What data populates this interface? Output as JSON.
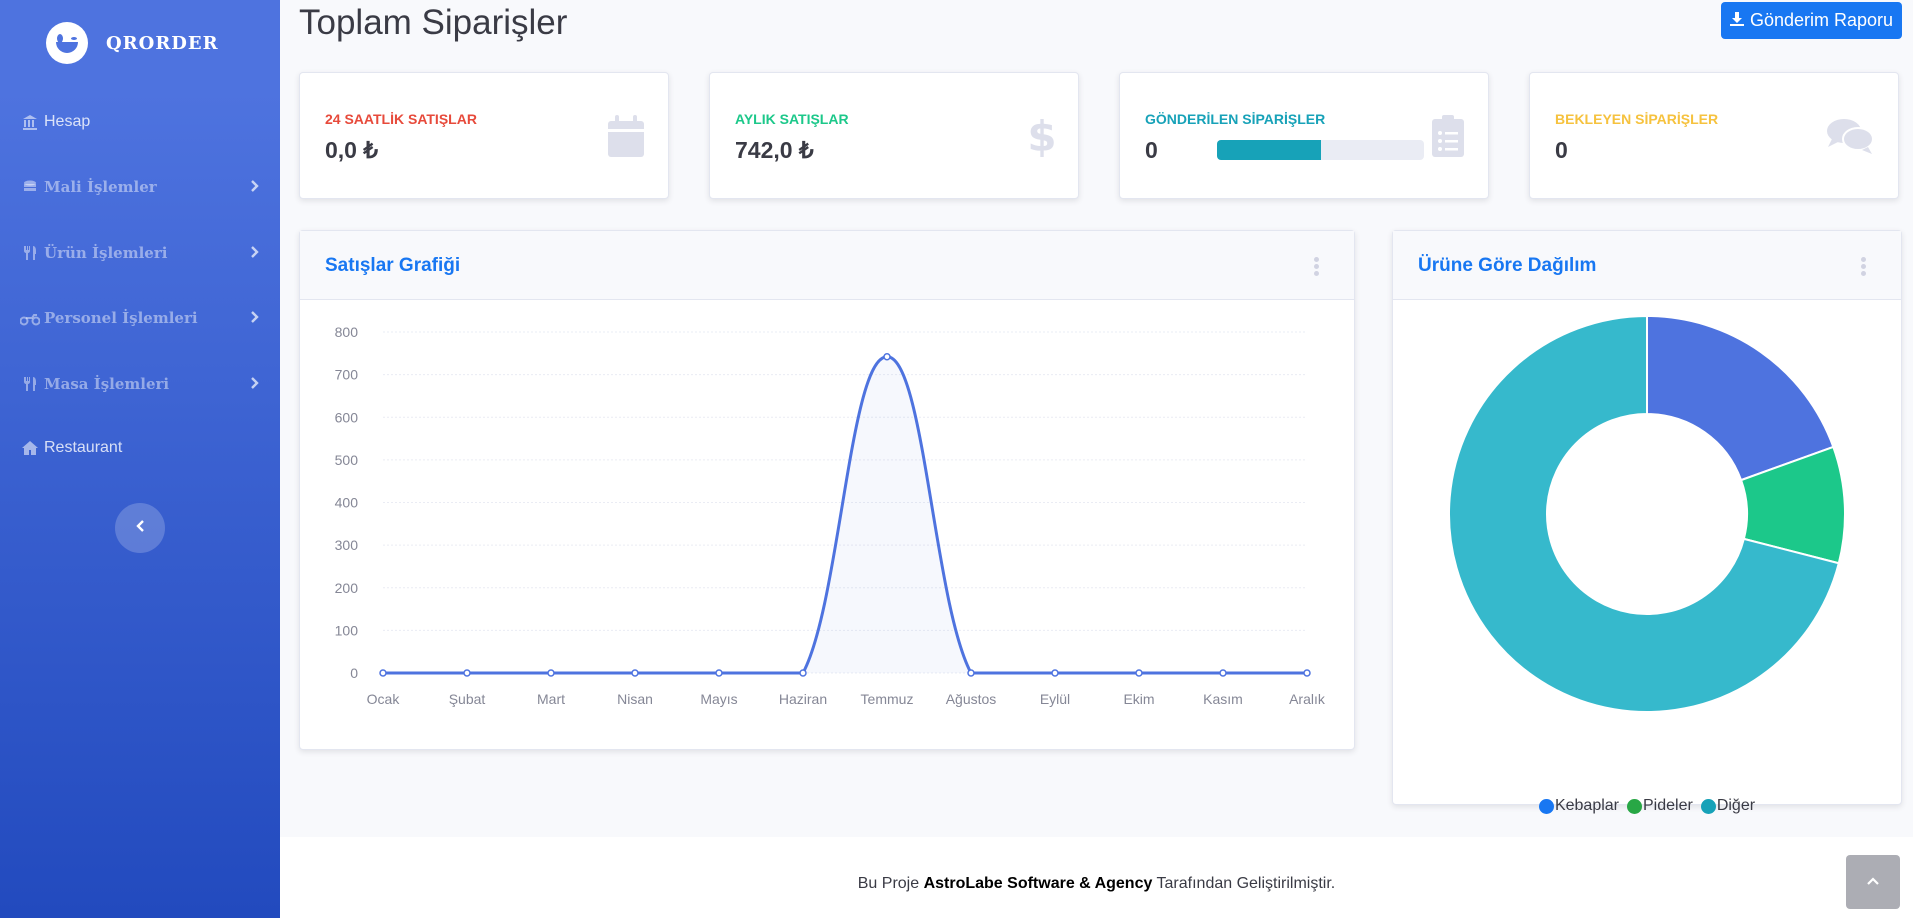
{
  "brand": {
    "name": "QRORDER"
  },
  "sidebar": {
    "items": [
      {
        "label": "Hesap"
      },
      {
        "label": "Mali İşlemler"
      },
      {
        "label": "Ürün İşlemleri"
      },
      {
        "label": "Personel İşlemleri"
      },
      {
        "label": "Masa İşlemleri"
      },
      {
        "label": "Restaurant"
      }
    ]
  },
  "header": {
    "title": "Toplam Siparişler",
    "report_button": "Gönderim Raporu"
  },
  "stats": [
    {
      "label": "24 SAATLİK SATIŞLAR",
      "value": "0,0 ₺",
      "color": "#e74a3b",
      "icon": "calendar-icon"
    },
    {
      "label": "AYLIK SATIŞLAR",
      "value": "742,0 ₺",
      "color": "#1cc88a",
      "icon": "dollar-icon"
    },
    {
      "label": "GÖNDERİLEN SİPARİŞLER",
      "value": "0",
      "color": "#17a2b8",
      "icon": "clipboard-list-icon",
      "progress": 0.5
    },
    {
      "label": "BEKLEYEN SİPARİŞLER",
      "value": "0",
      "color": "#f6c23e",
      "icon": "comments-icon"
    }
  ],
  "sales_chart": {
    "title": "Satışlar Grafiği",
    "chart_data": {
      "type": "area",
      "categories": [
        "Ocak",
        "Şubat",
        "Mart",
        "Nisan",
        "Mayıs",
        "Haziran",
        "Temmuz",
        "Ağustos",
        "Eylül",
        "Ekim",
        "Kasım",
        "Aralık"
      ],
      "series": [
        {
          "values": [
            0,
            0,
            0,
            0,
            0,
            0,
            742,
            0,
            0,
            0,
            0,
            0
          ]
        }
      ],
      "yticks": [
        0,
        100,
        200,
        300,
        400,
        500,
        600,
        700,
        800
      ],
      "ylim": [
        0,
        800
      ],
      "color": "#4e73df",
      "grid": true
    }
  },
  "distribution_chart": {
    "title": "Ürüne Göre Dağılım",
    "chart_data": {
      "type": "pie",
      "categories": [
        "Kebaplar",
        "Pideler",
        "Diğer"
      ],
      "values": [
        19.5,
        9.5,
        71
      ],
      "colors": [
        "#4e73df",
        "#1cc88a",
        "#36b9cc"
      ],
      "legend_colors": [
        "#1877f2",
        "#28a745",
        "#17a2b8"
      ],
      "legend": "bottom"
    }
  },
  "footer": {
    "prefix": "Bu Proje",
    "company": "AstroLabe Software & Agency",
    "suffix": "Tarafından Geliştirilmiştir."
  }
}
